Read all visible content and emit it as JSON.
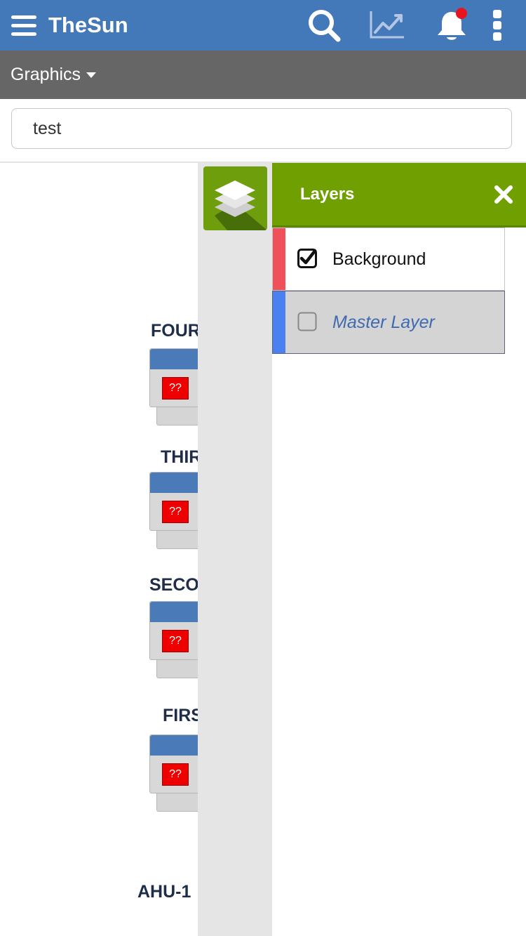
{
  "app": {
    "title": "TheSun",
    "icons": {
      "menu": "hamburger-menu-icon",
      "search": "search-icon",
      "trends": "trend-chart-icon",
      "notifications": "bell-icon",
      "more": "kebab-menu-icon"
    },
    "accent_color": "#4479b9",
    "notification_badge_color": "#e8141f"
  },
  "subheader": {
    "dropdown_label": "Graphics"
  },
  "search": {
    "value": "test"
  },
  "canvas": {
    "floors": [
      {
        "label": "FOUR",
        "badge": "??"
      },
      {
        "label": "THIR",
        "badge": "??"
      },
      {
        "label": "SECO",
        "badge": "??"
      },
      {
        "label": "FIRS",
        "badge": "??"
      }
    ],
    "ahu_label": "AHU-1",
    "badge_color": "#ee0000"
  },
  "layers_panel": {
    "title": "Layers",
    "header_color": "#6f9f00",
    "icons": {
      "toggle": "layers-icon",
      "close": "close-icon",
      "checked": "checkbox-checked-icon",
      "unchecked": "checkbox-unchecked-icon"
    },
    "layers": [
      {
        "name": "Background",
        "checked": true,
        "accent_color": "#f0505a"
      },
      {
        "name": "Master Layer",
        "checked": false,
        "accent_color": "#4a80f0"
      }
    ]
  }
}
